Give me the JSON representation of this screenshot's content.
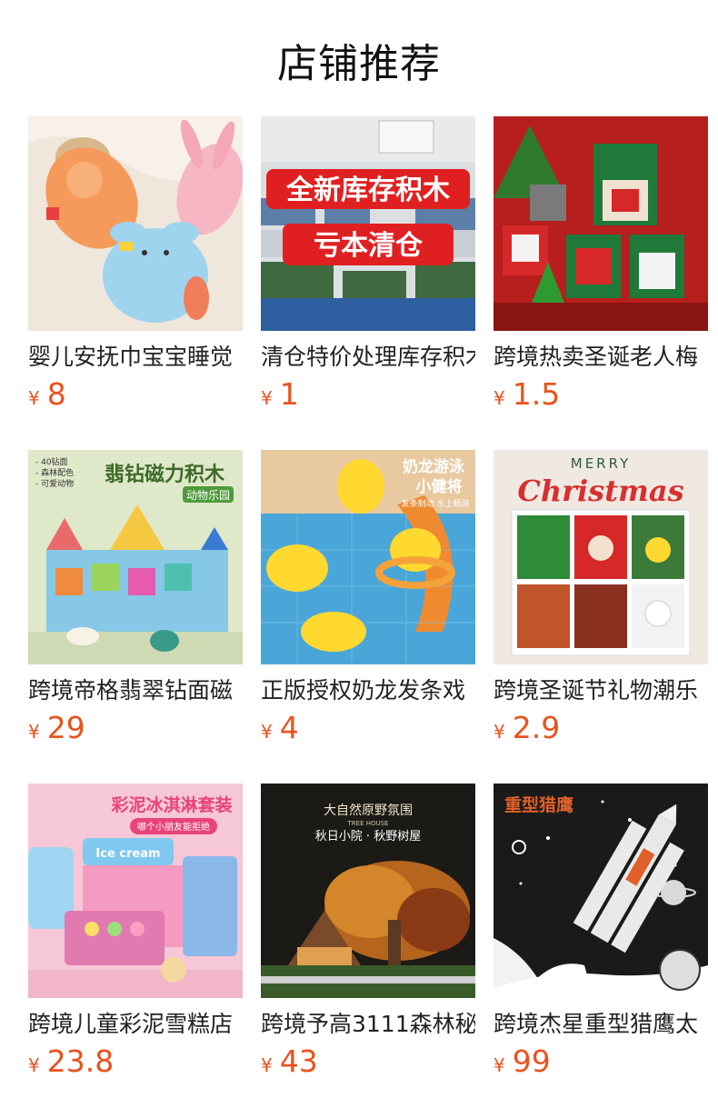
{
  "header": {
    "title": "店铺推荐"
  },
  "products": [
    {
      "name": "婴儿安抚巾宝宝睡觉",
      "currency": "¥",
      "price": "8",
      "image": "baby-comfort-toys"
    },
    {
      "name": "清仓特价处理库存积木",
      "currency": "¥",
      "price": "1",
      "image": "clearance-blocks-warehouse",
      "image_text": [
        "全新库存积木",
        "亏本清仓"
      ]
    },
    {
      "name": "跨境热卖圣诞老人梅",
      "currency": "¥",
      "price": "1.5",
      "image": "christmas-pixel-santa"
    },
    {
      "name": "跨境帝格翡翠钻面磁",
      "currency": "¥",
      "price": "29",
      "image": "magnetic-tiles-castle",
      "image_text": [
        "翡钻磁力积木",
        "动物乐园",
        "- 40钻面",
        "- 森林配色",
        "- 可爱动物"
      ]
    },
    {
      "name": "正版授权奶龙发条戏",
      "currency": "¥",
      "price": "4",
      "image": "yellow-duck-pool",
      "image_text": [
        "奶龙游泳",
        "小健将",
        "发条制动 水上畅游"
      ]
    },
    {
      "name": "跨境圣诞节礼物潮乐",
      "currency": "¥",
      "price": "2.9",
      "image": "christmas-block-display",
      "image_text": [
        "MERRY",
        "Christmas"
      ]
    },
    {
      "name": "跨境儿童彩泥雪糕店",
      "currency": "¥",
      "price": "23.8",
      "image": "ice-cream-play-set",
      "image_text": [
        "彩泥冰淇淋套装",
        "哪个小朋友能拒绝",
        "Ice cream"
      ]
    },
    {
      "name": "跨境予高3111森林秘",
      "currency": "¥",
      "price": "43",
      "image": "forest-treehouse",
      "image_text": [
        "大自然原野氛围",
        "TREE HOUSE",
        "秋日小院 · 秋野树屋"
      ]
    },
    {
      "name": "跨境杰星重型猎鹰太",
      "currency": "¥",
      "price": "99",
      "image": "falcon-rocket",
      "image_text": [
        "重型猎鹰"
      ]
    }
  ]
}
